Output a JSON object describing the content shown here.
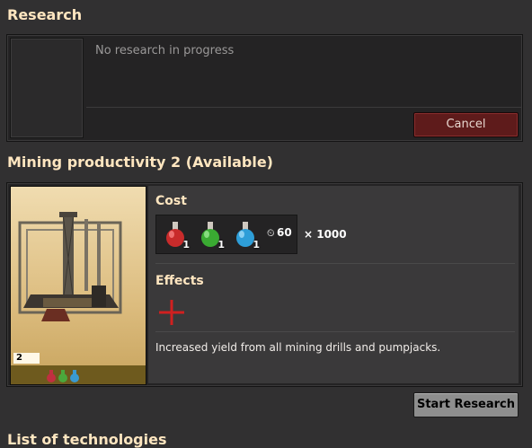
{
  "research": {
    "heading": "Research",
    "status_text": "No research in progress",
    "cancel_label": "Cancel"
  },
  "technology": {
    "heading": "Mining productivity 2 (Available)",
    "level": "2",
    "cost_heading": "Cost",
    "cost": {
      "packs": [
        {
          "icon": "automation-science-pack-icon",
          "color": "#d83030",
          "amount": "1"
        },
        {
          "icon": "logistic-science-pack-icon",
          "color": "#3cb83c",
          "amount": "1"
        },
        {
          "icon": "chemical-science-pack-icon",
          "color": "#3aa8d8",
          "amount": "1"
        }
      ],
      "time": "60",
      "multiplier": "× 1000"
    },
    "effects_heading": "Effects",
    "description": "Increased yield from all mining drills and pumpjacks.",
    "start_label": "Start Research"
  },
  "list_heading": "List of technologies"
}
